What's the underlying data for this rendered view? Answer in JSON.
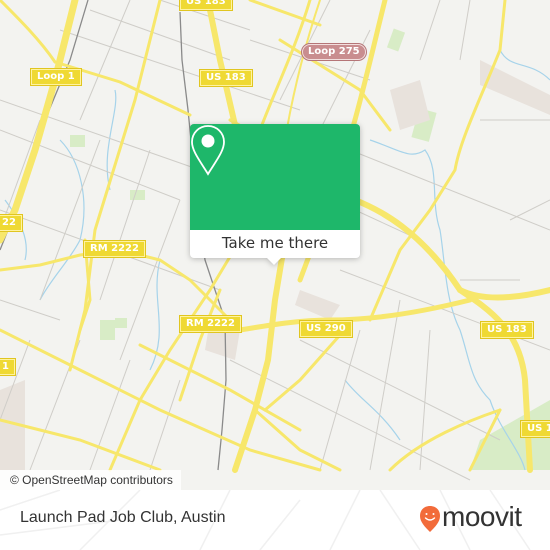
{
  "map": {
    "road_labels": [
      {
        "id": "us183-top",
        "text": "US 183",
        "type": "highway"
      },
      {
        "id": "loop1",
        "text": "Loop 1",
        "type": "highway"
      },
      {
        "id": "us183-mid",
        "text": "US 183",
        "type": "highway"
      },
      {
        "id": "loop275",
        "text": "Loop 275",
        "type": "loop"
      },
      {
        "id": "rm2222-left",
        "text": "RM 2222",
        "type": "highway"
      },
      {
        "id": "rm2222-right",
        "text": "RM 2222",
        "type": "highway"
      },
      {
        "id": "us290",
        "text": "US 290",
        "type": "highway"
      },
      {
        "id": "us183-right",
        "text": "US 183",
        "type": "highway"
      },
      {
        "id": "us183-edge",
        "text": "US 1",
        "type": "highway"
      },
      {
        "id": "left-edge-22",
        "text": "22",
        "type": "highway"
      },
      {
        "id": "left-edge-1",
        "text": "1",
        "type": "highway"
      }
    ],
    "attribution": "© OpenStreetMap contributors",
    "colors": {
      "background": "#f3f3f0",
      "major_road": "#f7e76b",
      "minor_road": "#c9c7c2",
      "water": "#a6d3ea",
      "park": "#cfe9b8"
    }
  },
  "popup": {
    "action_label": "Take me there",
    "icon": "map-pin-icon",
    "color": "#1eb76a"
  },
  "footer": {
    "place_name": "Launch Pad Job Club, Austin",
    "brand": "moovit",
    "brand_color": "#f26b3a"
  }
}
